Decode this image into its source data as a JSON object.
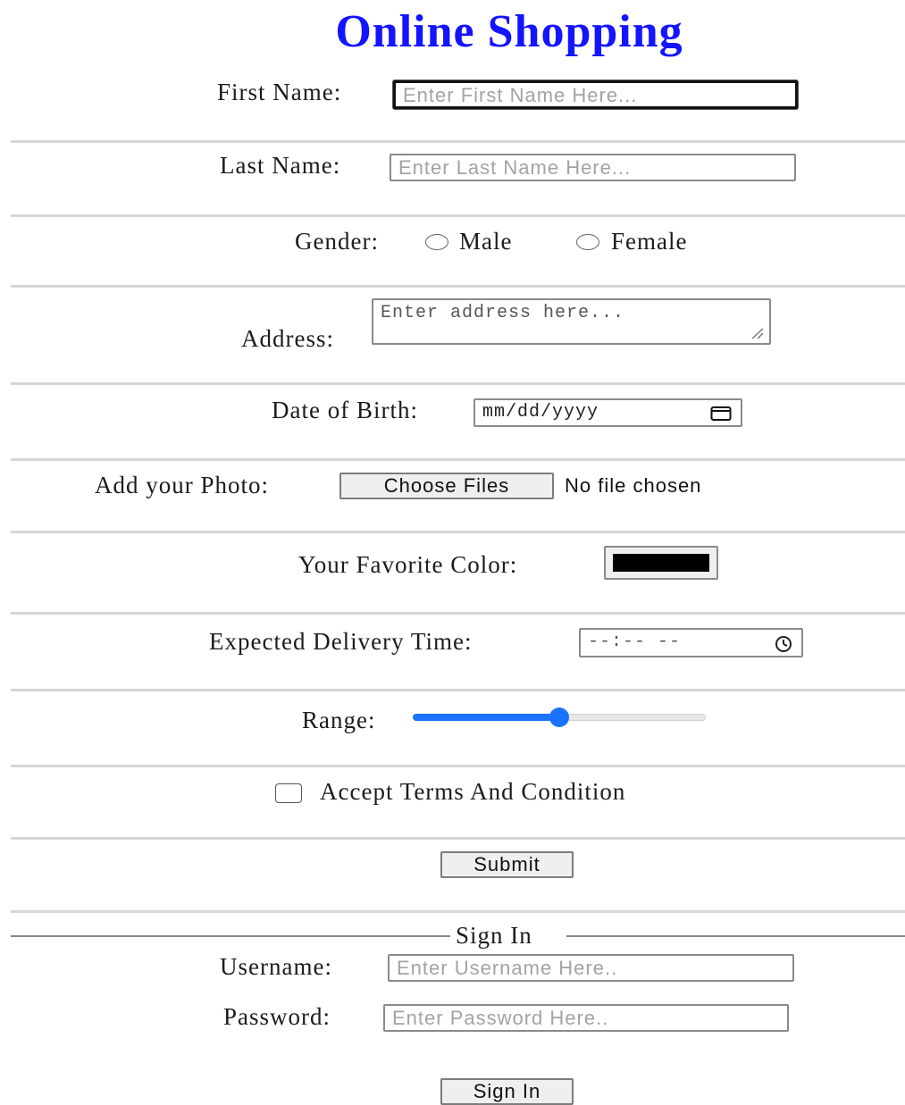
{
  "title": "Online Shopping",
  "first_name": {
    "label": "First Name:",
    "placeholder": "Enter First Name Here..."
  },
  "last_name": {
    "label": "Last Name:",
    "placeholder": "Enter Last Name Here..."
  },
  "gender": {
    "label": "Gender:",
    "options": [
      "Male",
      "Female"
    ]
  },
  "address": {
    "label": "Address:",
    "placeholder": "Enter address here..."
  },
  "dob": {
    "label": "Date of Birth:",
    "value": "mm/dd/yyyy"
  },
  "photo": {
    "label": "Add your Photo:",
    "button": "Choose Files",
    "status": "No file chosen"
  },
  "color": {
    "label": "Your Favorite Color:",
    "value": "#000000"
  },
  "delivery": {
    "label": "Expected Delivery Time:",
    "value": "--:-- --"
  },
  "range": {
    "label": "Range:",
    "value": 0.5,
    "accent": "#1a73ff"
  },
  "terms": {
    "label": "Accept Terms And Condition"
  },
  "submit": {
    "label": "Submit"
  },
  "signin": {
    "legend": "Sign In",
    "username": {
      "label": "Username:",
      "placeholder": "Enter Username Here.."
    },
    "password": {
      "label": "Password:",
      "placeholder": "Enter Password Here.."
    },
    "button": "Sign In"
  }
}
